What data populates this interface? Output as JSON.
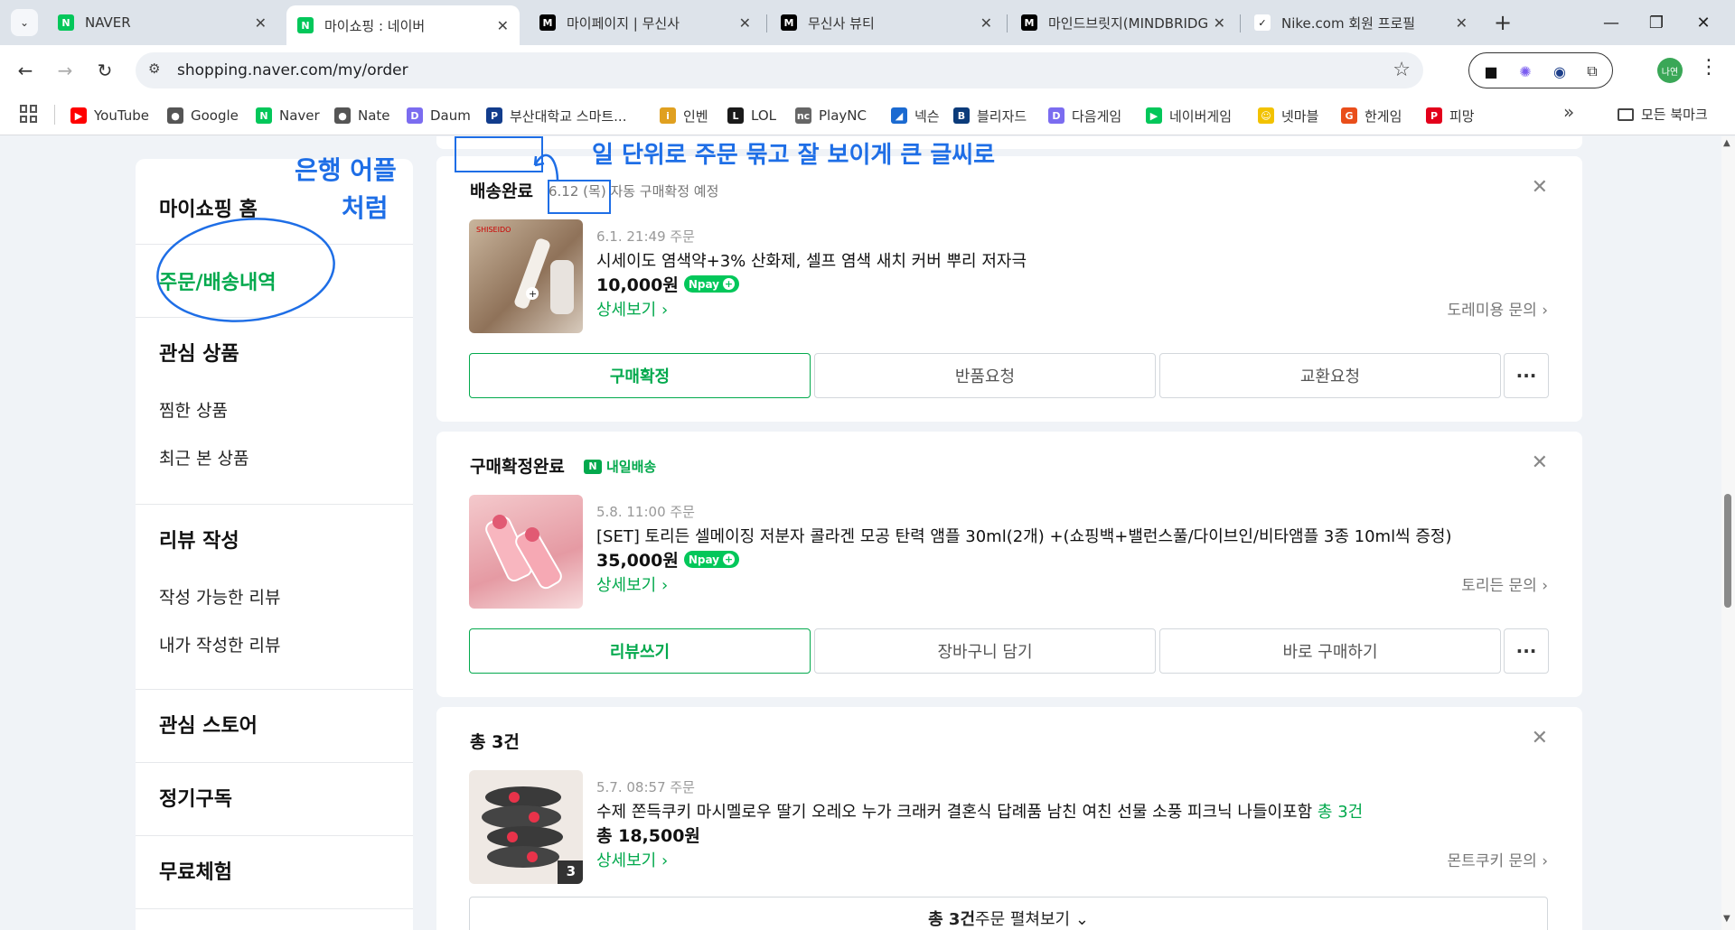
{
  "browser": {
    "tabs": [
      {
        "title": "NAVER",
        "favicon_text": "N",
        "favicon_color": "#03c75a",
        "active": false
      },
      {
        "title": "마이쇼핑 : 네이버",
        "favicon_text": "N",
        "favicon_color": "#03c75a",
        "active": true
      },
      {
        "title": "마이페이지 | 무신사",
        "favicon_text": "M",
        "favicon_color": "#000000",
        "active": false
      },
      {
        "title": "무신사 뷰티",
        "favicon_text": "M",
        "favicon_color": "#000000",
        "active": false
      },
      {
        "title": "마인드브릿지(MINDBRIDGE)",
        "favicon_text": "M",
        "favicon_color": "#000000",
        "active": false
      },
      {
        "title": "Nike.com 회원 프로필",
        "favicon_text": "✓",
        "favicon_color": "#ffffff",
        "active": false
      }
    ],
    "url": "shopping.naver.com/my/order",
    "profile_initials": "나연",
    "bookmarks": [
      {
        "label": "YouTube",
        "icon": "youtube-icon",
        "color": "#ff0000",
        "glyph": "▶"
      },
      {
        "label": "Google",
        "icon": "globe-icon",
        "color": "#555555",
        "glyph": "●"
      },
      {
        "label": "Naver",
        "icon": "naver-icon",
        "color": "#03c75a",
        "glyph": "N"
      },
      {
        "label": "Nate",
        "icon": "globe-icon",
        "color": "#555555",
        "glyph": "●"
      },
      {
        "label": "Daum",
        "icon": "daum-icon",
        "color": "#7b6cf0",
        "glyph": "D"
      },
      {
        "label": "부산대학교 스마트...",
        "icon": "pnu-icon",
        "color": "#123c8c",
        "glyph": "P"
      },
      {
        "label": "인벤",
        "icon": "inven-icon",
        "color": "#e0a020",
        "glyph": "i"
      },
      {
        "label": "LOL",
        "icon": "lol-icon",
        "color": "#1a1a1a",
        "glyph": "L"
      },
      {
        "label": "PlayNC",
        "icon": "plaync-icon",
        "color": "#666666",
        "glyph": "nc"
      },
      {
        "label": "넥슨",
        "icon": "nexon-icon",
        "color": "#1b6ad1",
        "glyph": "◢"
      },
      {
        "label": "블리자드",
        "icon": "blizzard-icon",
        "color": "#0b3b7a",
        "glyph": "B"
      },
      {
        "label": "다음게임",
        "icon": "daumgame-icon",
        "color": "#7b6cf0",
        "glyph": "D"
      },
      {
        "label": "네이버게임",
        "icon": "navergame-icon",
        "color": "#03c75a",
        "glyph": "▶"
      },
      {
        "label": "넷마블",
        "icon": "netmarble-icon",
        "color": "#f2c200",
        "glyph": "☺"
      },
      {
        "label": "한게임",
        "icon": "hangame-icon",
        "color": "#e94e1b",
        "glyph": "G"
      },
      {
        "label": "피망",
        "icon": "pmang-icon",
        "color": "#e3001b",
        "glyph": "P"
      }
    ],
    "bookmarks_folder": "모든 북마크"
  },
  "sidebar": {
    "home": "마이쇼핑 홈",
    "orders": "주문/배송내역",
    "interest": "관심 상품",
    "wish": "찜한 상품",
    "recent": "최근 본 상품",
    "review": "리뷰 작성",
    "review_available": "작성 가능한 리뷰",
    "review_mine": "내가 작성한 리뷰",
    "store": "관심 스토어",
    "subscription": "정기구독",
    "trial": "무료체험"
  },
  "orders": [
    {
      "status": "배송완료",
      "sub": "6.12 (목) 자동 구매확정 예정",
      "ordered": "6.1. 21:49 주문",
      "name": "시세이도 염색약+3% 산화제, 셀프 염색 새치 커버 뿌리 저자극",
      "price": "10,000원",
      "npay": "pay",
      "detail": "상세보기 ›",
      "inquiry": "도레미용 문의 ›",
      "buttons": [
        "구매확정",
        "반품요청",
        "교환요청",
        "···"
      ]
    },
    {
      "status": "구매확정완료",
      "tomorrow": "내일배송",
      "ordered": "5.8. 11:00 주문",
      "name": "[SET] 토리든 셀메이징 저분자 콜라겐 모공 탄력 앰플 30ml(2개) +(쇼핑백+밸런스풀/다이브인/비타앰플 3종 10ml씩 증정)",
      "price": "35,000원",
      "npay": "pay",
      "detail": "상세보기 ›",
      "inquiry": "토리든 문의 ›",
      "buttons": [
        "리뷰쓰기",
        "장바구니 담기",
        "바로 구매하기",
        "···"
      ]
    },
    {
      "status": "총 3건",
      "ordered": "5.7. 08:57 주문",
      "name": "수제 쫀득쿠키 마시멜로우 딸기 오레오 누가 크래커 결혼식 답례품 남친 여친 선물 소풍 피크닉 나들이포함",
      "count_label": "총 3건",
      "price": "총 18,500원",
      "thumb_badge": "3",
      "detail": "상세보기 ›",
      "inquiry": "몬트쿠키 문의 ›",
      "expand_bold": "총 3건",
      "expand_rest": " 주문 펼쳐보기 ⌄"
    }
  ],
  "annotations": {
    "top_note": "일 단위로 주문 묶고 잘 보이게 큰 글씨로",
    "side_note_1": "은행 어플",
    "side_note_2": "처럼"
  },
  "colors": {
    "accent": "#03a94d",
    "annotation": "#1e6ee6"
  }
}
